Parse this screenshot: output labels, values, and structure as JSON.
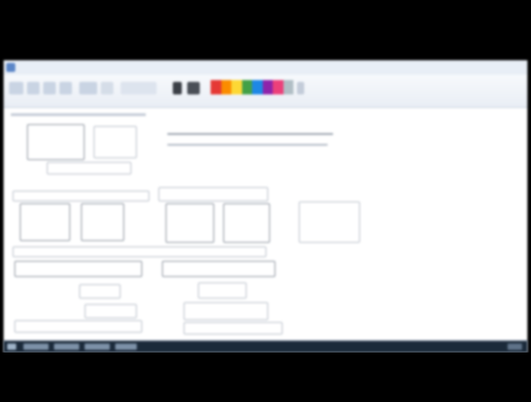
{
  "window": {
    "app_icon": "paint-app-icon"
  },
  "ribbon": {
    "tools": [
      "select-icon",
      "crop-icon",
      "resize-icon",
      "rotate-icon",
      "pencil-icon",
      "fill-icon",
      "text-icon",
      "eraser-icon",
      "picker-icon",
      "brush-icon"
    ],
    "palette_colors": [
      "#e53935",
      "#fb8c00",
      "#fdd835",
      "#43a047",
      "#1e88e5",
      "#8e24aa",
      "#ec407a",
      "#b0bec5"
    ]
  },
  "taskbar": {
    "items": [
      "start-button",
      "task-item-1",
      "task-item-2",
      "task-item-3",
      "task-item-4",
      "task-item-5"
    ]
  }
}
